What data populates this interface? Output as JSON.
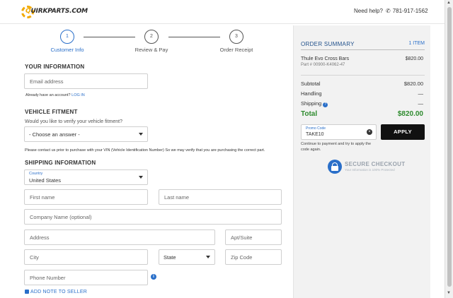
{
  "header": {
    "logo_text_q": "Q",
    "logo_text_rest": "UIRKPARTS.COM",
    "help_label": "Need help?",
    "phone_icon": "phone-icon",
    "phone": "781-917-1562"
  },
  "stepper": {
    "steps": [
      {
        "number": "1",
        "label": "Customer Info"
      },
      {
        "number": "2",
        "label": "Review & Pay"
      },
      {
        "number": "3",
        "label": "Order Receipt"
      }
    ]
  },
  "your_info": {
    "title": "YOUR INFORMATION",
    "email_placeholder": "Email address",
    "account_prompt": "Already have an account?",
    "login_link": "LOG IN"
  },
  "vehicle": {
    "title": "VEHICLE FITMENT",
    "question": "Would you like to verify your vehicle fitment?",
    "select_value": "- Choose an answer -",
    "note": "Please contact us prior to purchase with your VIN (Vehicle Identification Number) So we may verify that you are purchasing the correct part."
  },
  "shipping": {
    "title": "SHIPPING INFORMATION",
    "country_label": "Country",
    "country_value": "United States",
    "first_name_placeholder": "First name",
    "last_name_placeholder": "Last name",
    "company_placeholder": "Company Name (optional)",
    "address_placeholder": "Address",
    "apt_placeholder": "Apt/Suite",
    "city_placeholder": "City",
    "state_value": "State",
    "zip_placeholder": "Zip Code",
    "phone_placeholder": "Phone Number",
    "info_icon": "info-icon",
    "add_note": "ADD NOTE TO SELLER"
  },
  "summary": {
    "title": "ORDER SUMMARY",
    "item_count": "1 ITEM",
    "product_name": "Thule Evo Cross Bars",
    "product_part": "Part # 00900-K4062-47",
    "product_price": "$820.00",
    "subtotal_label": "Subtotal",
    "subtotal_value": "$820.00",
    "handling_label": "Handling",
    "handling_value": "—",
    "shipping_label": "Shipping",
    "shipping_value": "—",
    "total_label": "Total",
    "total_value": "$820.00",
    "promo_label": "Promo Code",
    "promo_value": "TAKE10",
    "apply_label": "APPLY",
    "promo_note": "Continue to payment and try to apply the code again.",
    "secure_title": "SECURE CHECKOUT",
    "secure_sub": "Your Information is 100% Protected",
    "colors": {
      "accent": "#2a6fc9",
      "total": "#2e8b2e",
      "apply_bg": "#111111"
    }
  }
}
